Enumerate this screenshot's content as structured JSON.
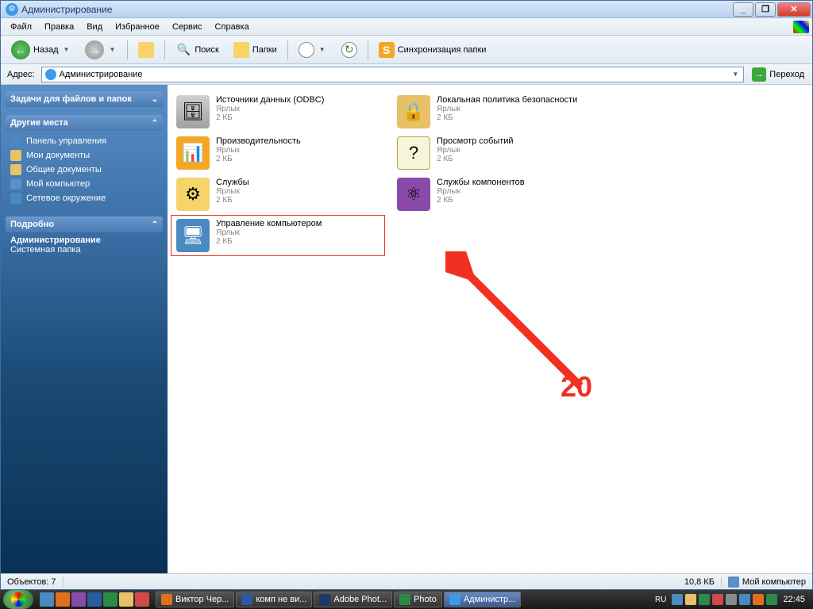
{
  "window": {
    "title": "Администрирование"
  },
  "menu": {
    "file": "Файл",
    "edit": "Правка",
    "view": "Вид",
    "favorites": "Избранное",
    "tools": "Сервис",
    "help": "Справка"
  },
  "toolbar": {
    "back": "Назад",
    "search": "Поиск",
    "folders": "Папки",
    "sync": "Синхронизация папки"
  },
  "address": {
    "label": "Адрес:",
    "value": "Администрирование",
    "go": "Переход"
  },
  "sidebar": {
    "tasks_header": "Задачи для файлов и папок",
    "places_header": "Другие места",
    "places": {
      "control_panel": "Панель управления",
      "my_documents": "Мои документы",
      "shared_documents": "Общие документы",
      "my_computer": "Мой компьютер",
      "network": "Сетевое окружение"
    },
    "details_header": "Подробно",
    "details": {
      "name": "Администрирование",
      "type": "Системная папка"
    }
  },
  "items": [
    {
      "name": "Источники данных (ODBC)",
      "type": "Ярлык",
      "size": "2 КБ",
      "icon": "ic-odbc"
    },
    {
      "name": "Локальная политика безопасности",
      "type": "Ярлык",
      "size": "2 КБ",
      "icon": "ic-sec"
    },
    {
      "name": "Производительность",
      "type": "Ярлык",
      "size": "2 КБ",
      "icon": "ic-perf"
    },
    {
      "name": "Просмотр событий",
      "type": "Ярлык",
      "size": "2 КБ",
      "icon": "ic-event"
    },
    {
      "name": "Службы",
      "type": "Ярлык",
      "size": "2 КБ",
      "icon": "ic-svc"
    },
    {
      "name": "Службы компонентов",
      "type": "Ярлык",
      "size": "2 КБ",
      "icon": "ic-comp"
    },
    {
      "name": "Управление компьютером",
      "type": "Ярлык",
      "size": "2 КБ",
      "icon": "ic-mgmt",
      "highlighted": true
    }
  ],
  "annotation": {
    "number": "20"
  },
  "statusbar": {
    "objects": "Объектов: 7",
    "size": "10,8 КБ",
    "location": "Мой компьютер"
  },
  "taskbar": {
    "tasks": [
      {
        "label": "Виктор Чер...",
        "color": "#e07020"
      },
      {
        "label": "комп не ви...",
        "color": "#2a5aa0"
      },
      {
        "label": "Adobe Phot...",
        "color": "#1a3a6a"
      },
      {
        "label": "Photo",
        "color": "#2a8a4a"
      },
      {
        "label": "Администр...",
        "color": "#3b9be8",
        "active": true
      }
    ],
    "lang": "RU",
    "clock": "22:45"
  }
}
